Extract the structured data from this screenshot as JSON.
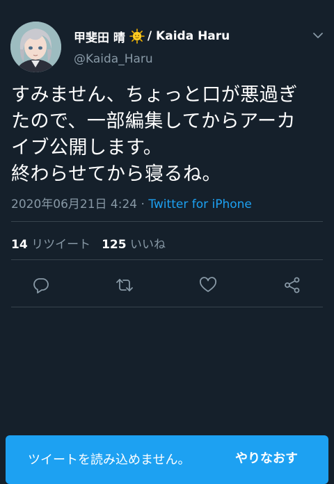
{
  "author": {
    "name": "甲斐田 晴",
    "name_suffix": "/ Kaida Haru",
    "handle": "@Kaida_Haru",
    "name_emoji": "sun-with-face-icon"
  },
  "tweet": {
    "text_lines": [
      "すみません、ちょっと口が悪過ぎ",
      "たので、一部編集してからアーカ",
      "イブ公開します。",
      "終わらせてから寝るね。"
    ],
    "timestamp": "2020年06月21日 4:24",
    "separator": " · ",
    "source": "Twitter for iPhone"
  },
  "stats": {
    "retweet_count": "14",
    "retweet_label": "リツイート",
    "like_count": "125",
    "like_label": "いいね"
  },
  "actions": [
    "reply-icon",
    "retweet-icon",
    "like-icon",
    "share-icon"
  ],
  "toast": {
    "message": "ツイートを読み込めません。",
    "retry_label": "やりなおす"
  },
  "colors": {
    "background": "#15202b",
    "accent": "#1da1f2",
    "secondary_text": "#8899a6",
    "divider": "#38444d"
  }
}
